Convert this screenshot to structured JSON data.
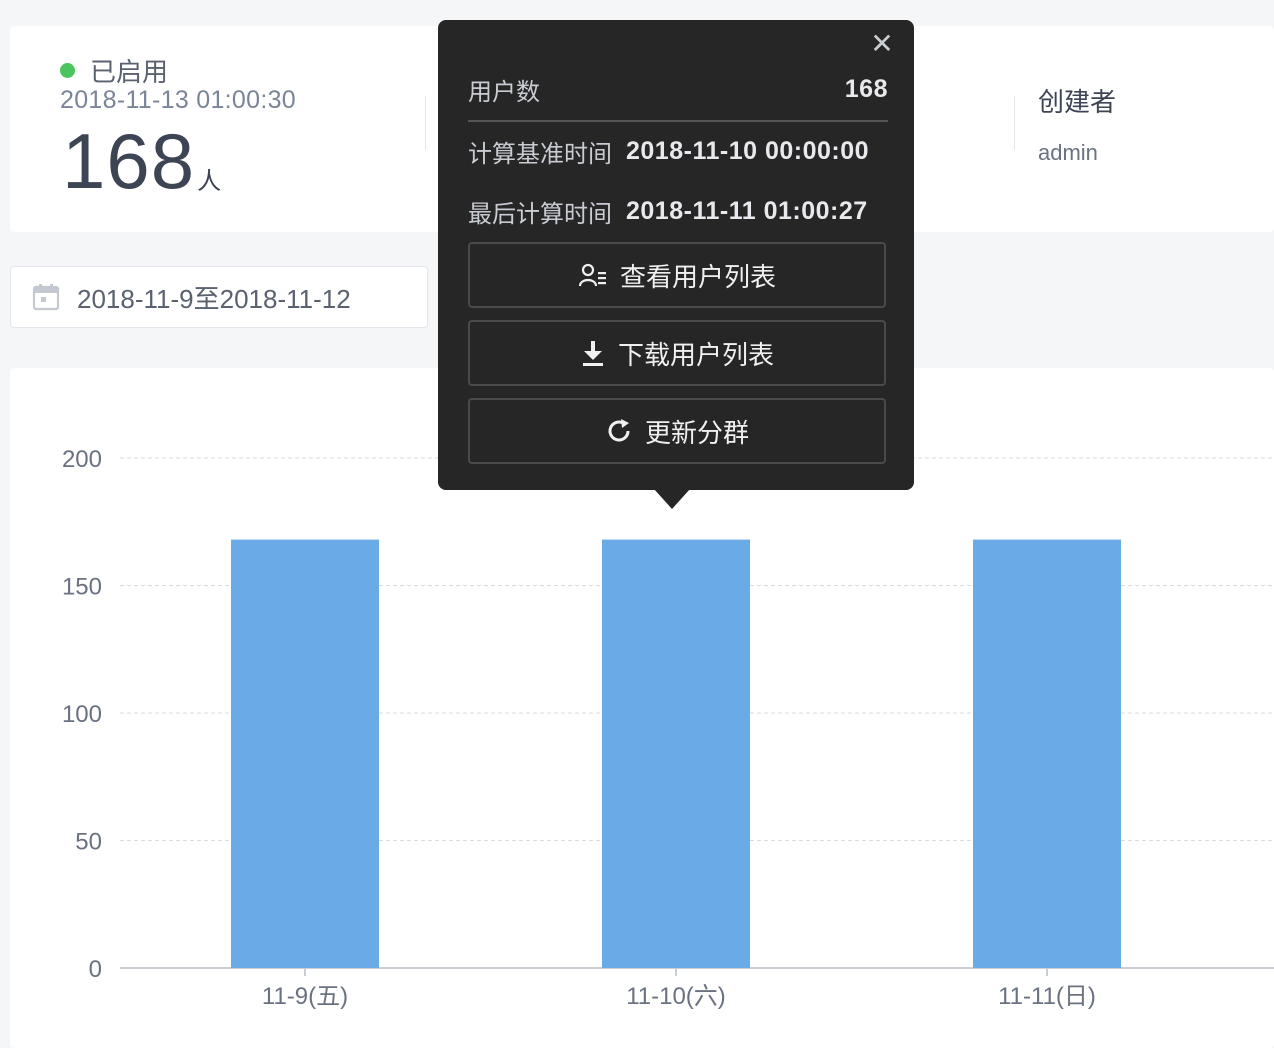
{
  "summary": {
    "status": "已启用",
    "status_color": "#4cc45f",
    "timestamp": "2018-11-13 01:00:30",
    "count": "168",
    "count_unit": "人",
    "creator_label": "创建者",
    "creator": "admin"
  },
  "date_filter": {
    "icon": "calendar-icon",
    "value": "2018-11-9至2018-11-12"
  },
  "popover": {
    "rows": [
      {
        "label": "用户数",
        "value": "168"
      },
      {
        "label": "计算基准时间",
        "value": "2018-11-10 00:00:00"
      },
      {
        "label": "最后计算时间",
        "value": "2018-11-11 01:00:27"
      }
    ],
    "buttons": [
      {
        "icon": "user-list-icon",
        "label": "查看用户列表"
      },
      {
        "icon": "download-icon",
        "label": "下载用户列表"
      },
      {
        "icon": "refresh-icon",
        "label": "更新分群"
      }
    ],
    "close_icon": "close-icon"
  },
  "chart_data": {
    "type": "bar",
    "categories": [
      "11-9(五)",
      "11-10(六)",
      "11-11(日)"
    ],
    "values": [
      168,
      168,
      168
    ],
    "yticks": [
      0,
      50,
      100,
      150,
      200
    ],
    "ylim": [
      0,
      200
    ],
    "grid": true,
    "bar_color": "#6aaae6"
  }
}
